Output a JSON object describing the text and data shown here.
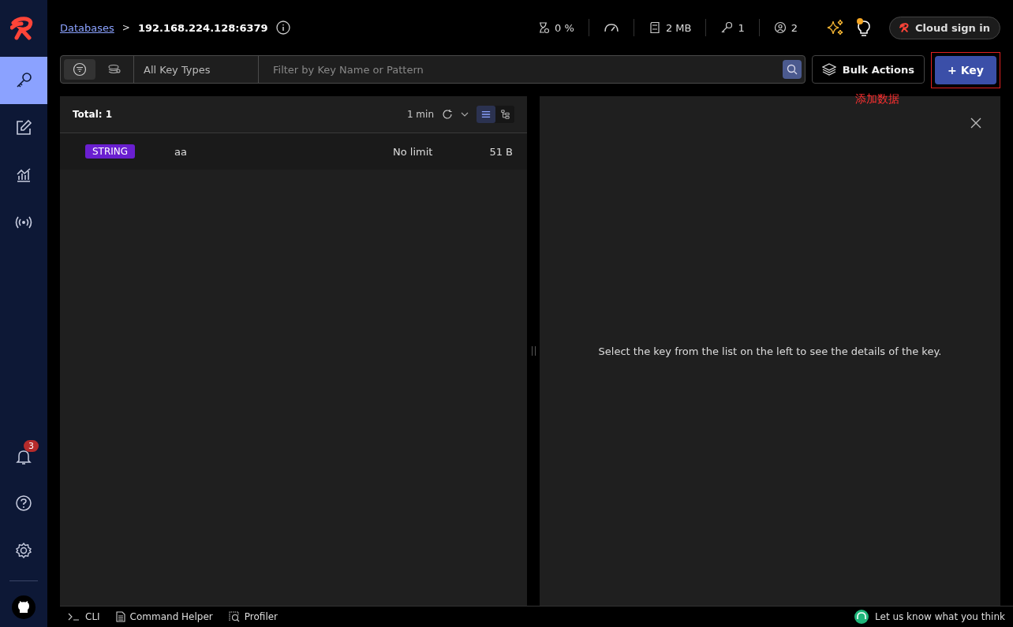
{
  "breadcrumb": {
    "link": "Databases",
    "separator": ">",
    "current": "192.168.224.128:6379"
  },
  "stats": [
    {
      "kind": "cpu",
      "value": "0 %"
    },
    {
      "kind": "ops"
    },
    {
      "kind": "memory",
      "value": "2 MB"
    },
    {
      "kind": "keys",
      "value": "1"
    },
    {
      "kind": "clients",
      "value": "2"
    }
  ],
  "cloud_button": "Cloud sign in",
  "sidebar": {
    "items": [
      {
        "kind": "browser",
        "selected": true
      },
      {
        "kind": "workbench",
        "selected": false
      },
      {
        "kind": "analysis",
        "selected": false
      },
      {
        "kind": "pubsub",
        "selected": false
      }
    ],
    "notifications_badge": "3"
  },
  "filter": {
    "modes": [
      {
        "kind": "filter",
        "selected": true
      },
      {
        "kind": "search",
        "selected": false
      }
    ],
    "key_type": "All Key Types",
    "placeholder": "Filter by Key Name or Pattern"
  },
  "bulk_actions": "Bulk Actions",
  "add_key": "+ Key",
  "annotation": "添加数据",
  "key_list": {
    "total": "Total: 1",
    "refresh": "1 min",
    "views": [
      {
        "kind": "list",
        "selected": true
      },
      {
        "kind": "tree",
        "selected": false
      }
    ],
    "rows": [
      {
        "type": "STRING",
        "color": "#6a1fd0",
        "name": "aa",
        "ttl": "No limit",
        "size": "51 B"
      }
    ]
  },
  "details": {
    "message": "Select the key from the list on the left to see the details of the key."
  },
  "bottom_bar": {
    "tabs": [
      {
        "kind": "cli",
        "label": "CLI"
      },
      {
        "kind": "helper",
        "label": "Command Helper"
      },
      {
        "kind": "profiler",
        "label": "Profiler"
      }
    ],
    "feedback": "Let us know what you think"
  }
}
